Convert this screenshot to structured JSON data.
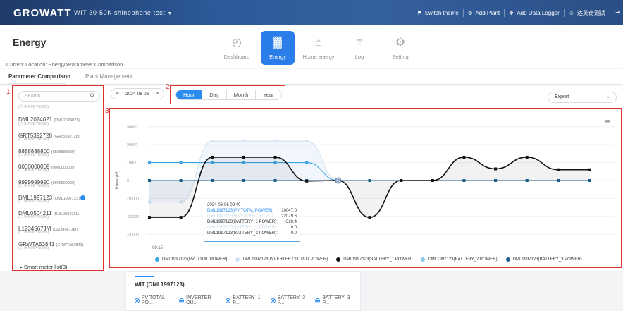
{
  "topbar": {
    "logo": "GROWATT",
    "plant": "WIT 30-50K shinephone test",
    "actions": [
      {
        "icon": "shirt-icon",
        "glyph": "⚑",
        "label": "Switch theme"
      },
      {
        "icon": "plus-circle-icon",
        "glyph": "⊕",
        "label": "Add Plant"
      },
      {
        "icon": "logger-icon",
        "glyph": "❖",
        "label": "Add Data Logger"
      },
      {
        "icon": "user-icon",
        "glyph": "☺",
        "label": "达芙奇测试"
      }
    ],
    "exit_glyph": "⇥"
  },
  "header": {
    "title": "Energy",
    "tabs": [
      {
        "icon": "dashboard-icon",
        "glyph": "◴",
        "label": "Dashboard"
      },
      {
        "icon": "energy-bars-icon",
        "glyph": "▓",
        "label": "Energy"
      },
      {
        "icon": "home-icon",
        "glyph": "⌂",
        "label": "Home energy"
      },
      {
        "icon": "log-icon",
        "glyph": "≡",
        "label": "Log"
      },
      {
        "icon": "gear-icon",
        "glyph": "⚙",
        "label": "Setting"
      }
    ],
    "active_tab": "Energy"
  },
  "breadcrumb": "Current Location: Energy>Parameter Comparison",
  "subtabs": [
    "Parameter Comparison",
    "Plant Management"
  ],
  "annotations": [
    "1",
    "2",
    "3"
  ],
  "sidebar": {
    "search_placeholder": "Search",
    "devices": [
      {
        "sub": "(❒ IKN0DY60D6)",
        "main": "",
        "code": ""
      },
      {
        "sub": "",
        "main": "DML2024021",
        "code": "(DML2024021)"
      },
      {
        "sub": "(❒ IKN0DY60D6)",
        "main": "GRT5392728",
        "code": "(GRT5392728)"
      },
      {
        "sub": "(❒ IKN0DY60D6)",
        "main": "8888888800",
        "code": "(8888888800)"
      },
      {
        "sub": "(❒ IKN0DY60D6)",
        "main": "0000000009",
        "code": "(0000000009)"
      },
      {
        "sub": "(❒ IKN0DY60D6)",
        "main": "9999999990",
        "code": "(9999999990)"
      },
      {
        "sub": "(❒ IKN0DY60D6)",
        "main": "DML1997123",
        "code": "(DML1997123)",
        "checked": true
      },
      {
        "sub": "(❒ IKN0DY60D6)",
        "main": "DML0504211",
        "code": "(DML0504211)"
      },
      {
        "sub": "(❒ IKN0DY60D6)",
        "main": "L1234567JM",
        "code": "(L1234567JM)"
      },
      {
        "sub": "(❒ IKN0DY60D6)",
        "main": "GRWTA53841",
        "code": "(GRWTA53841)"
      },
      {
        "sub": "(❒ IKN0DY60D6)",
        "main": "",
        "code": ""
      }
    ],
    "smart_meter": "▸ Smart meter list(3)"
  },
  "toolbar": {
    "date": "2024-06-06",
    "prev_glyph": "◀",
    "next_glyph": "▶",
    "periods": [
      "Hour",
      "Day",
      "Month",
      "Year"
    ],
    "active_period": "Hour",
    "export_label": "Export",
    "export_glyph": "⌄"
  },
  "chart_data": {
    "type": "line",
    "ylabel": "Power(W)",
    "x_start_label": "09:15",
    "ylim": [
      -35000,
      35000
    ],
    "yticks": [
      30000,
      20000,
      10000,
      0,
      -10000,
      -20000,
      -30000
    ],
    "series": [
      {
        "name": "DML1997123(PV TOTAL POWER)",
        "color": "#3aa3e3",
        "values": [
          10000,
          10000,
          10000,
          10000,
          10000,
          10000,
          0,
          0,
          0,
          0,
          0,
          0,
          0,
          0,
          0,
          0,
          0,
          0
        ]
      },
      {
        "name": "DML1997123(INVERTER OUTPUT POWER)",
        "color": "#cfe4f5",
        "values": [
          -12000,
          -12000,
          22000,
          22000,
          22000,
          22000,
          0,
          0,
          0,
          0,
          0,
          0,
          0,
          0,
          0,
          0,
          0,
          0
        ]
      },
      {
        "name": "DML1997123(BATTERY_1 POWER)",
        "color": "#111111",
        "values": [
          -20500,
          -20500,
          13000,
          13000,
          13000,
          -300,
          0,
          -20500,
          0,
          0,
          13000,
          6500,
          13000,
          6000,
          6000
        ]
      },
      {
        "name": "DML1997123(BATTERY_2 POWER)",
        "color": "#8ccaf0",
        "values": [
          0,
          0,
          0,
          0,
          0,
          0,
          0,
          0,
          0,
          0,
          0,
          0,
          0,
          0,
          0
        ]
      },
      {
        "name": "DML1997123(BATTERY_3 POWER)",
        "color": "#1f5f8b",
        "values": [
          0,
          0,
          0,
          0,
          0,
          0,
          0,
          0,
          0,
          0,
          0,
          0,
          0,
          0,
          0
        ]
      }
    ],
    "tooltip": {
      "time": "2024-06-06 09:40",
      "rows": [
        {
          "label": "DML1997123(PV TOTAL POWER):",
          "value": "10047.0",
          "style": "blue"
        },
        {
          "label": "DML1997123(INVERTER OUTPUT POWER):",
          "value": "22079.6",
          "style": "faint"
        },
        {
          "label": "DML1997123(BATTERY_1 POWER):",
          "value": "-320.4",
          "style": ""
        },
        {
          "label": "DML1997123(BATTERY_2 POWER):",
          "value": "0.0",
          "style": "faint"
        },
        {
          "label": "DML1997123(BATTERY_3 POWER):",
          "value": "0.0",
          "style": ""
        }
      ]
    }
  },
  "card": {
    "title": "WIT (DML1997123)",
    "options": [
      "PV TOTAL PO...",
      "INVERTER OU...",
      "BATTERY_1 P...",
      "BATTERY_2 P...",
      "BATTERY_3 P..."
    ]
  }
}
